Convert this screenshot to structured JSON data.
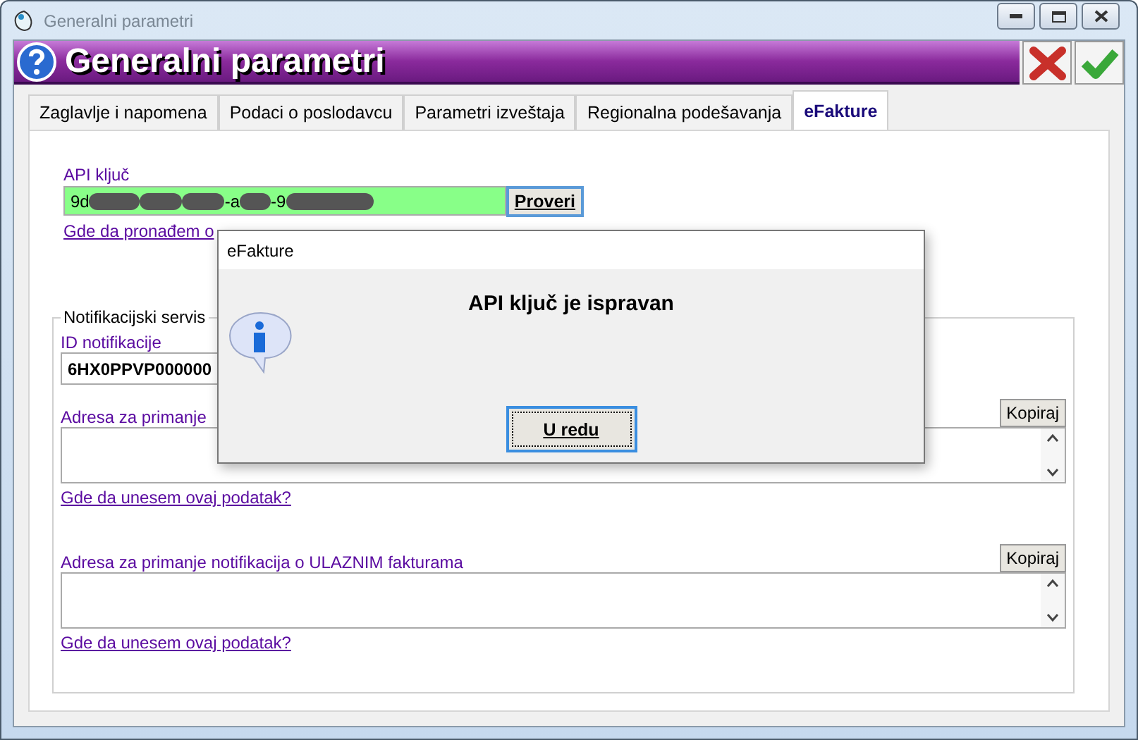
{
  "window": {
    "title": "Generalni parametri"
  },
  "header": {
    "title": "Generalni parametri"
  },
  "tabs": [
    {
      "label": "Zaglavlje i napomena",
      "selected": false
    },
    {
      "label": "Podaci o poslodavcu",
      "selected": false
    },
    {
      "label": "Parametri izveštaja",
      "selected": false
    },
    {
      "label": "Regionalna podešavanja",
      "selected": false
    },
    {
      "label": "eFakture",
      "selected": true
    }
  ],
  "api_key": {
    "label": "API ključ",
    "valid": true,
    "check_button": "Proveri",
    "help_link": "Gde da pronađem o",
    "value_parts": [
      {
        "kind": "text",
        "text": "9d"
      },
      {
        "kind": "redacted"
      },
      {
        "kind": "redacted"
      },
      {
        "kind": "redacted"
      },
      {
        "kind": "text",
        "text": "-a"
      },
      {
        "kind": "redacted"
      },
      {
        "kind": "text",
        "text": "-9"
      },
      {
        "kind": "redacted"
      }
    ]
  },
  "notifications": {
    "legend": "Notifikacijski servis",
    "id_label": "ID notifikacije",
    "id_value": "6HX0PPVP000000",
    "addresses": [
      {
        "label": "Adresa za primanje",
        "copy_button": "Kopiraj",
        "help_link": "Gde da unesem ovaj podatak?"
      },
      {
        "label": "Adresa za primanje notifikacija o ULAZNIM fakturama",
        "copy_button": "Kopiraj",
        "help_link": "Gde da unesem ovaj podatak?"
      }
    ]
  },
  "dialog": {
    "title": "eFakture",
    "message": "API ključ je ispravan",
    "button": "U redu"
  }
}
